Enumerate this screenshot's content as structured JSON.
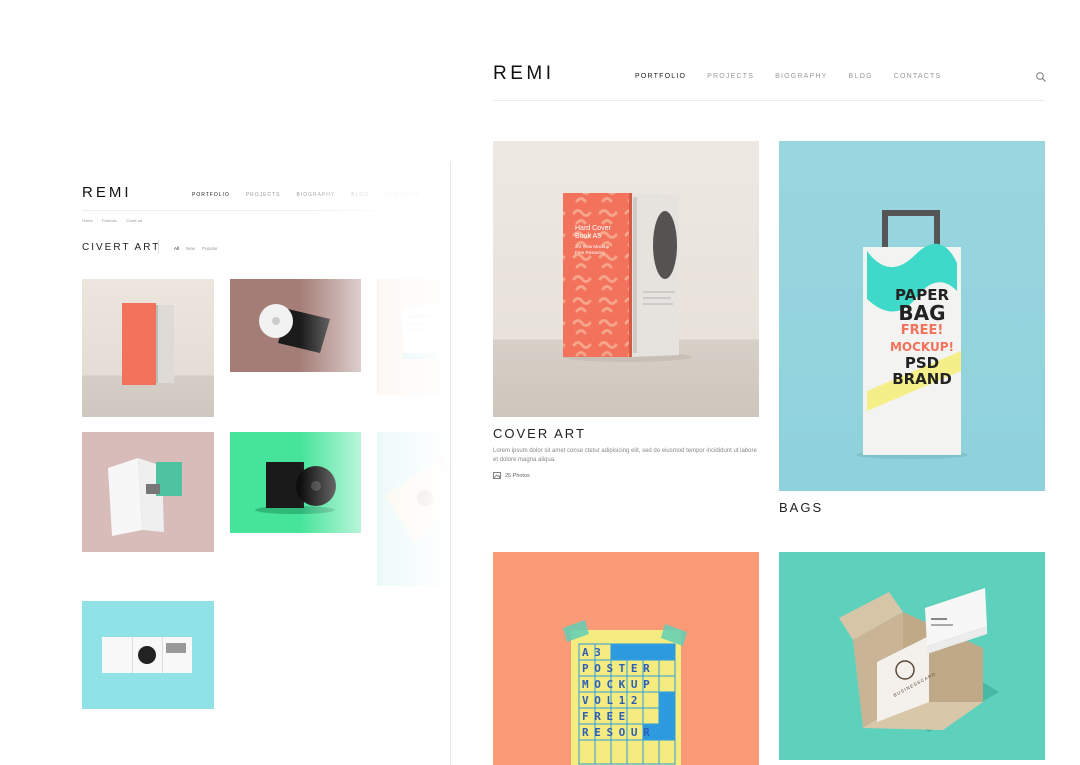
{
  "back_page": {
    "logo": "REMI",
    "nav": [
      "PORTFOLIO",
      "PROJECTS",
      "BIOGRAPHY",
      "BLOG",
      "CONTACTS"
    ],
    "breadcrumb": [
      "Home",
      "Portfolio",
      "Civert art"
    ],
    "title": "CIVERT ART",
    "filters": [
      "All",
      "New",
      "Popular"
    ]
  },
  "front_page": {
    "logo": "REMI",
    "nav": [
      "PORTFOLIO",
      "PROJECTS",
      "BIOGRAPHY",
      "BLOG",
      "CONTACTS"
    ],
    "cards": [
      {
        "title": "COVER ART",
        "description": "Lorem ipsum dolor sit amet conse ctetur adipisicing elit, sed do eiusmod tempor incididunt ut labore et dolore magna aliqua.",
        "photo_count": "25 Photos",
        "book_text": [
          "Hard Cover",
          "Book A5",
          "2/4 View Mockup",
          "Free Resource"
        ]
      },
      {
        "title": "BAGS",
        "bag_text": [
          "PAPER",
          "BAG",
          "FREE!",
          "MOCKUP!",
          "PSD",
          "BRAND"
        ]
      },
      {
        "title": "",
        "poster_rows": [
          "A3",
          "POSTER",
          "MOCKUP",
          "VOL12",
          "FREE",
          "RESOUR"
        ]
      },
      {
        "title": "",
        "card_text": "BUSINESSCARD"
      }
    ]
  },
  "colors": {
    "accent_coral": "#f2725b",
    "poster_yellow": "#f4ec7e",
    "poster_blue": "#2e9be0",
    "bag_teal": "#3ed9c8",
    "mint_bg": "#5ed1bd"
  }
}
